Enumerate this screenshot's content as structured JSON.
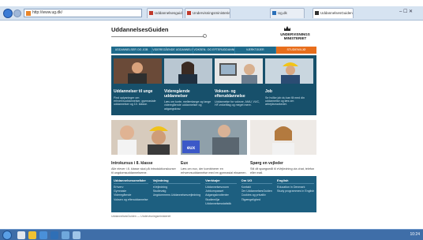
{
  "browser": {
    "address_text": "http://www.ug.dk/",
    "tabs": [
      {
        "label": "Uddannelsesguiden",
        "active": false
      },
      {
        "label": "Undervisningsministeriet",
        "active": false
      },
      {
        "label": "Ug.dk",
        "active": false
      },
      {
        "label": "UddannelsesGuiden",
        "active": true
      }
    ],
    "window_controls": "– ☐ ✕"
  },
  "site": {
    "logo": "UddannelsesGuiden",
    "ministry": "UNDERVISNINGS MINISTERIET",
    "nav": [
      "UDDANNELSER OG JOB",
      "VIDEREGÅENDE UDDANNELSER",
      "VOKSEN- OG EFTERUDDANNELSE",
      "VÆRKTØJER",
      "STUDIEMILJØ"
    ],
    "cards": [
      {
        "title": "Uddannelser til unge",
        "desc": "Find oplysninger om erhvervsuddannelser, gymnasiale uddannelser og 10. klasse."
      },
      {
        "title": "Videregående uddannelser",
        "desc": "Læs om korte, mellemlange og lange videregående uddannelser og adgangskrav."
      },
      {
        "title": "Voksen- og efteruddannelse",
        "desc": "Uddannelse for voksne, AMU, VUC, HF-enkeltfag og meget mere."
      },
      {
        "title": "Job",
        "desc": "Se hvilke job du kan få med din uddannelse og læs om arbejdsmarkedet."
      }
    ],
    "lower": [
      {
        "title": "Introkursus i 8. klasse",
        "desc": "Alle elever i 8. klasse skal på introduktionskurser til ungdomsuddannelserne."
      },
      {
        "title": "Eux",
        "desc": "Læs om eux, der kombinerer en erhvervsuddannelse med en gymnasial eksamen."
      },
      {
        "title": "Spørg en vejleder",
        "desc": "Stil dit spørgsmål til eVejledning via chat, telefon eller mail."
      }
    ],
    "footer": [
      {
        "head": "Uddannelsesområder",
        "links": [
          "Erhverv",
          "Gymnasie",
          "Videregående",
          "Voksen og efteruddannelse"
        ]
      },
      {
        "head": "Vejledning",
        "links": [
          "eVejledning",
          "Studievalg",
          "Ungdommens Uddannelsesvejledning"
        ]
      },
      {
        "head": "Værktøjer",
        "links": [
          "Uddannelseszoom",
          "Jobkompasset",
          "Adgangskvotienter",
          "Studiemiljø",
          "Uddannelsesstatistik"
        ]
      },
      {
        "head": "Om UG",
        "links": [
          "Kontakt",
          "Om UddannelsesGuiden",
          "Cookies og privatliv",
          "Tilgængelighed"
        ]
      },
      {
        "head": "English",
        "links": [
          "Education in Denmark",
          "Study programmes in English"
        ]
      }
    ],
    "fine_print": "UddannelsesGuiden — Undervisningsministeriet"
  },
  "taskbar": {
    "clock": "10:24"
  },
  "colors": {
    "nav_bg": "#1f6b8c",
    "feature_bg": "#17506b",
    "accent": "#e86e1c",
    "footer_bg": "#1d5f80"
  }
}
